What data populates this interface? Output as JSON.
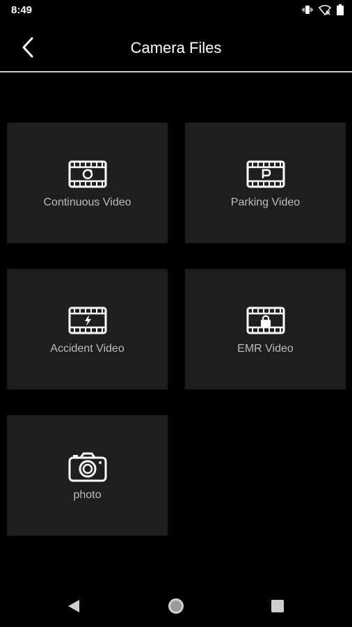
{
  "status_bar": {
    "time": "8:49",
    "icons": [
      "vibrate-icon",
      "wifi-off-icon",
      "battery-icon"
    ]
  },
  "header": {
    "title": "Camera Files",
    "back_icon": "chevron-left-icon"
  },
  "tiles": [
    {
      "label": "Continuous Video",
      "icon": "film-loop-icon"
    },
    {
      "label": "Parking Video",
      "icon": "film-parking-icon"
    },
    {
      "label": "Accident Video",
      "icon": "film-lightning-icon"
    },
    {
      "label": "EMR Video",
      "icon": "film-lock-icon"
    },
    {
      "label": "photo",
      "icon": "camera-icon"
    }
  ],
  "nav_bar": {
    "buttons": [
      "back-triangle-icon",
      "home-circle-icon",
      "recents-square-icon"
    ]
  },
  "colors": {
    "background": "#000000",
    "tile": "#1e1e1e",
    "tile_label": "#bdbdbd",
    "divider": "#cfcfcf"
  }
}
